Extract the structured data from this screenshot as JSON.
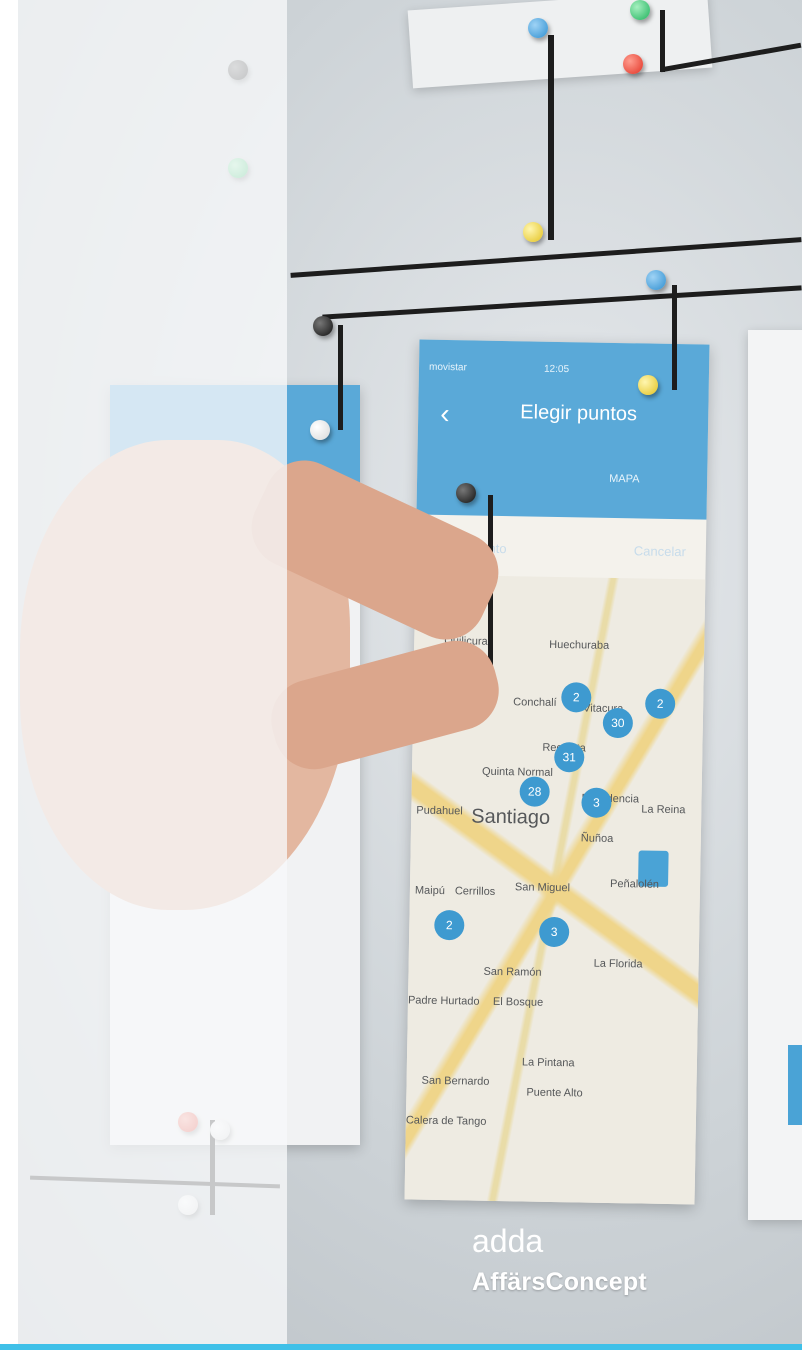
{
  "image": {
    "kind": "photo",
    "brand": {
      "logo_text": "adda",
      "name": "AffärsConcept",
      "text_color": "#ffffff"
    },
    "colors": {
      "overlay": "#f7f8fa",
      "accent_rule": "#3fc0e8",
      "app_header": "#5aa9d8"
    },
    "phone_mockup": {
      "status": "movistar",
      "time": "12:05",
      "back_glyph": "‹",
      "title": "Elegir puntos",
      "tab": "MAPA",
      "search_placeholder": "Buscar punto",
      "cancel": "Cancelar",
      "map_labels": [
        "Quilicura",
        "Huechuraba",
        "Conchalí",
        "Vitacura",
        "Recoleta",
        "Quinta Normal",
        "Providencia",
        "Pudahuel",
        "Santiago",
        "La Reina",
        "Ñuñoa",
        "Maipú",
        "Cerrillos",
        "San Miguel",
        "Peñalolén",
        "San Ramón",
        "La Florida",
        "El Bosque",
        "La Pintana",
        "San Bernardo",
        "Puente Alto",
        "Padre Hurtado",
        "Calera de Tango"
      ],
      "cluster_counts": [
        "2",
        "2",
        "30",
        "31",
        "28",
        "3",
        "2",
        "3"
      ]
    }
  }
}
